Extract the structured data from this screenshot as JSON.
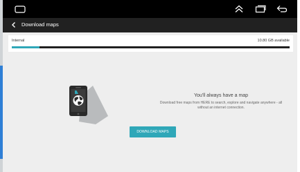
{
  "header": {
    "title": "Download maps"
  },
  "storage": {
    "label": "Internal",
    "free_text": "10.80 GB available",
    "used_fraction": 0.1
  },
  "promo": {
    "heading": "You'll always have a map",
    "body": "Download free maps from HERE to search, explore and navigate anywhere - all without an internet connection."
  },
  "actions": {
    "download_label": "DOWNLOAD MAPS"
  },
  "icons": {
    "home": "home-icon",
    "recents": "double-chevron-up-icon",
    "overview": "overview-icon",
    "back": "back-arrow-icon",
    "title_back": "chevron-left-icon",
    "phone": "phone-globe-icon"
  },
  "colors": {
    "accent": "#2fa7b8",
    "title_bar": "#212121",
    "system_bar": "#000000",
    "background": "#eeeeee"
  }
}
